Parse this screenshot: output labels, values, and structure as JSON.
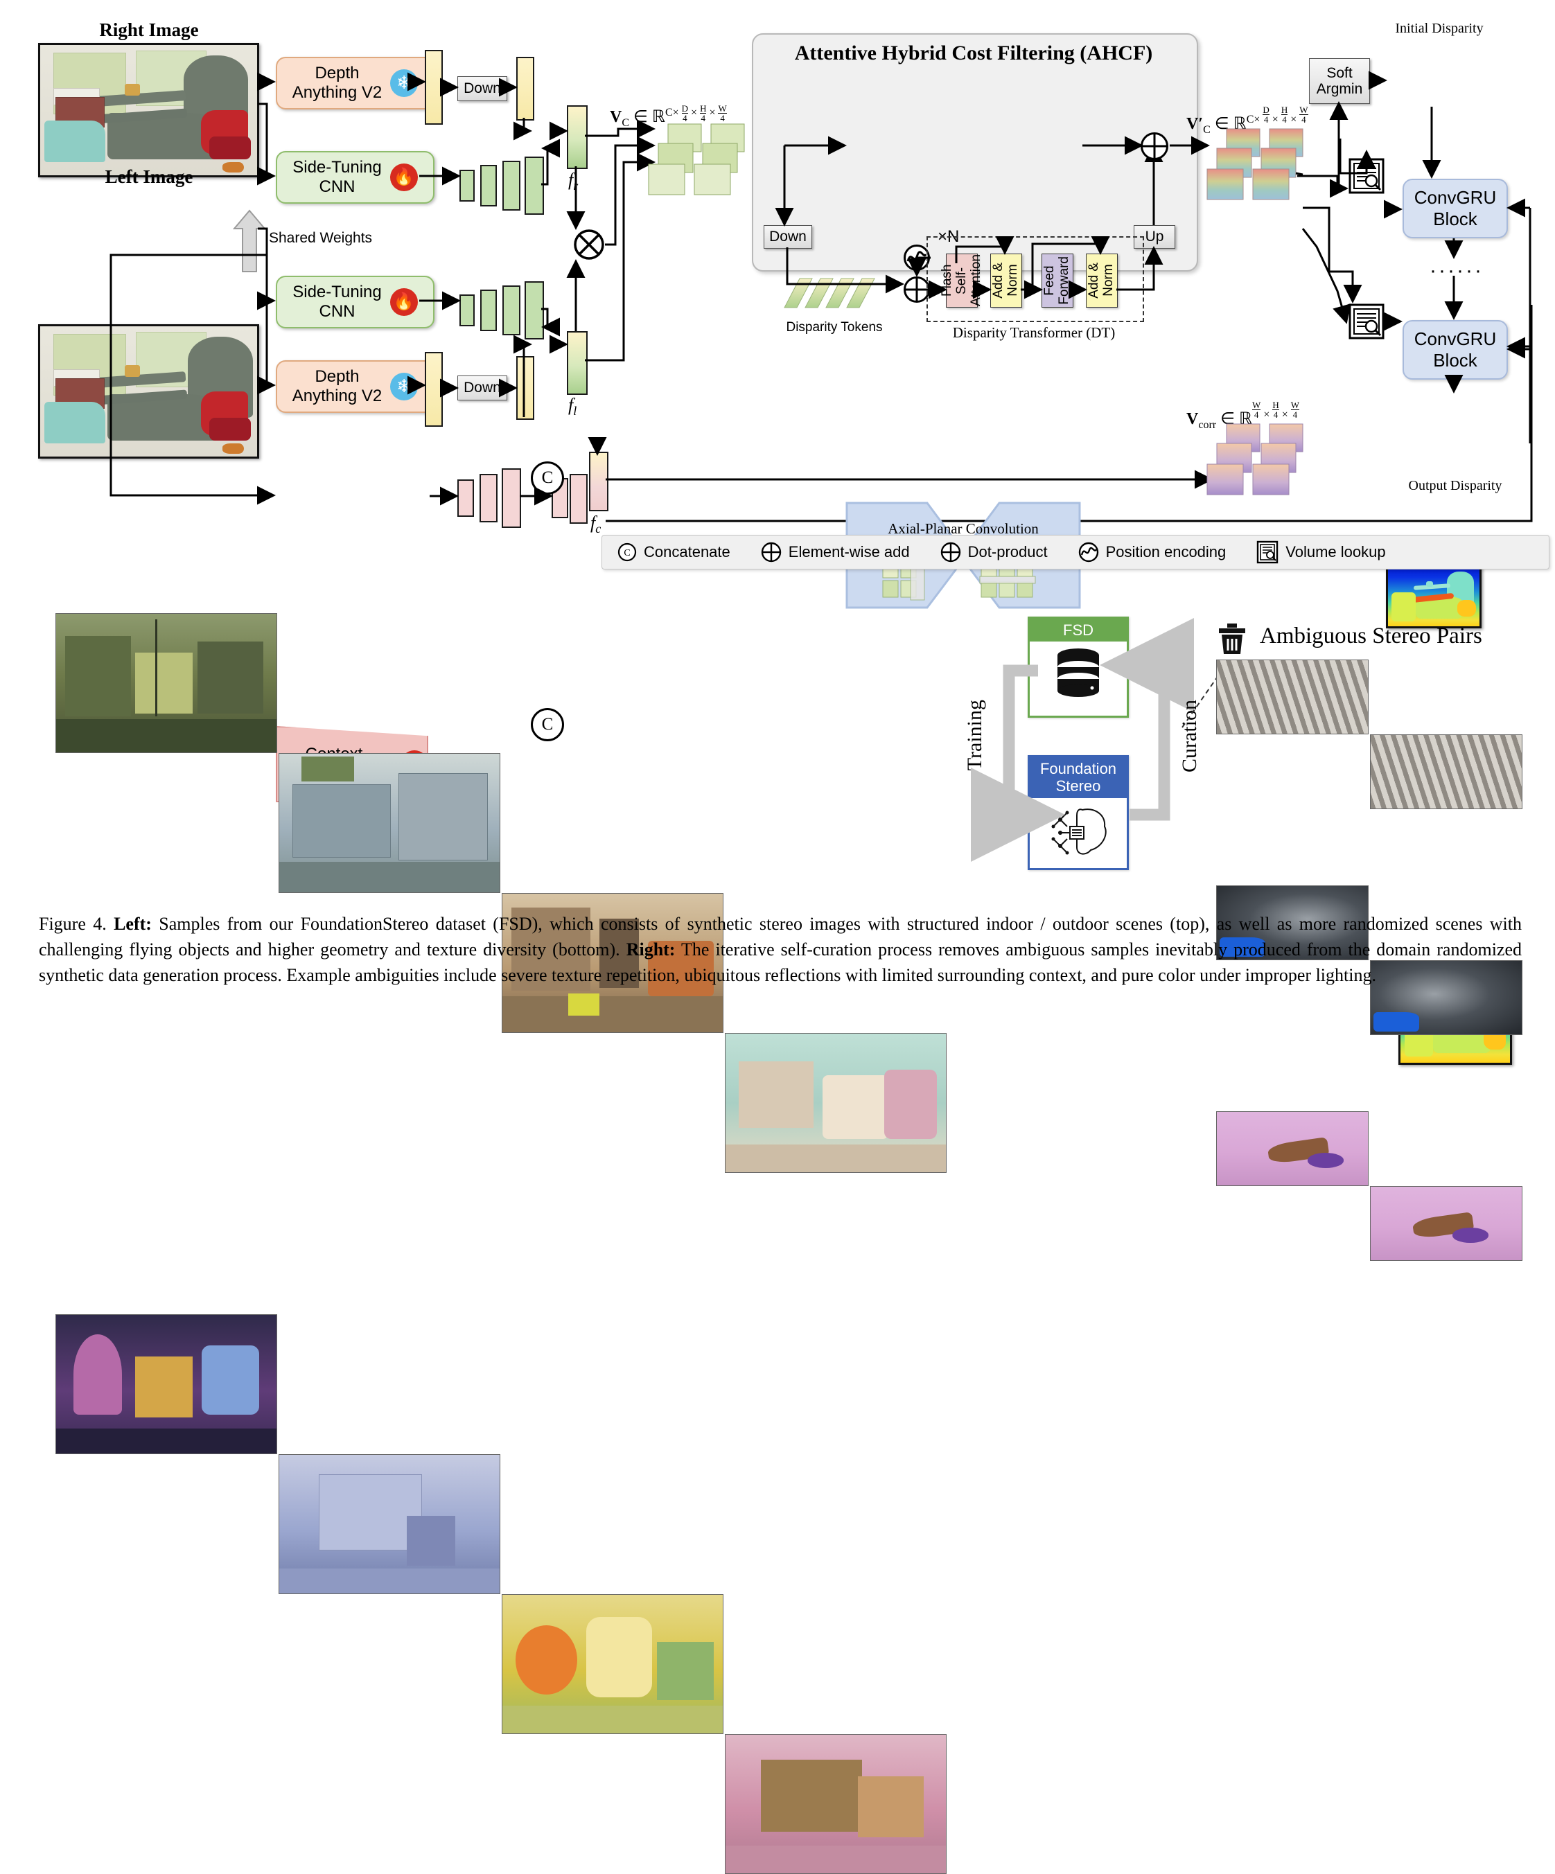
{
  "figure": {
    "number": "Figure 4.",
    "caption_parts": {
      "left_bold": "Left:",
      "left_text": " Samples from our FoundationStereo dataset (FSD), which consists of synthetic stereo images with structured indoor / outdoor scenes (top), as well as more randomized scenes with challenging flying objects and higher geometry and texture diversity (bottom). ",
      "right_bold": "Right:",
      "right_text": " The iterative self-curation process removes ambiguous samples inevitably produced from the domain randomized synthetic data generation process. Example ambiguities include severe texture repetition, ubiquitous reflections with limited surrounding context, and pure color under improper lighting."
    }
  },
  "pipeline": {
    "right_image_label": "Right Image",
    "left_image_label": "Left Image",
    "depth_anything_label": "Depth\nAnything V2",
    "side_tuning_label": "Side-Tuning\nCNN",
    "context_network_label": "Context\nNetwork",
    "shared_weights_label": "Shared Weights",
    "down_label": "Down",
    "up_label": "Up",
    "soft_argmin_label": "Soft\nArgmin",
    "convgru_label": "ConvGRU\nBlock",
    "initial_disparity_label": "Initial Disparity",
    "output_disparity_label": "Output Disparity",
    "ellipsis": "······",
    "f_r": "f",
    "f_r_sub": "r",
    "f_l": "f",
    "f_l_sub": "l",
    "f_c": "f",
    "f_c_sub": "c",
    "snowflake_icon": "frozen-icon",
    "fire_icon": "trainable-icon",
    "tensors": {
      "vc": "V",
      "vc_sub": "C",
      "vc_space": " ∈ ℝ",
      "vc_dims": [
        "C×",
        "D",
        "4",
        "H",
        "4",
        "W",
        "4"
      ],
      "vc_prime": "V′",
      "vcorr": "V",
      "vcorr_sub": "corr"
    }
  },
  "ahcf": {
    "title": "Attentive Hybrid Cost Filtering (AHCF)",
    "apc_label": "Axial-Planar Convolution\n(APC) Filtering",
    "repeat_label": "×N",
    "disparity_tokens_label": "Disparity Tokens",
    "dt_label": "Disparity Transformer (DT)",
    "dt_blocks": [
      {
        "name": "flash-self-attention",
        "label": "Flash Self-\nAttention",
        "color": "#f0cecb"
      },
      {
        "name": "add-norm-1",
        "label": "Add &\nNorm",
        "color": "#fbf7b8"
      },
      {
        "name": "feed-forward",
        "label": "Feed\nForward",
        "color": "#cdc4e0"
      },
      {
        "name": "add-norm-2",
        "label": "Add &\nNorm",
        "color": "#fbf7b8"
      }
    ]
  },
  "legend": {
    "items": [
      {
        "icon": "concatenate-icon",
        "glyph": "C",
        "label": "Concatenate"
      },
      {
        "icon": "element-wise-add-icon",
        "glyph": "plus-circle",
        "label": "Element-wise add"
      },
      {
        "icon": "dot-product-icon",
        "glyph": "plus-circle",
        "label": "Dot-product"
      },
      {
        "icon": "position-encoding-icon",
        "glyph": "sine-circle",
        "label": "Position encoding"
      },
      {
        "icon": "volume-lookup-icon",
        "glyph": "document-search",
        "label": "Volume lookup"
      }
    ]
  },
  "curation": {
    "fsd_label": "FSD",
    "foundation_stereo_label": "Foundation\nStereo",
    "training_label": "Training",
    "curation_label": "Curation",
    "ambiguous_label": "Ambiguous Stereo Pairs",
    "trash_icon": "trash-icon",
    "database_icon": "database-icon",
    "brain_chip_icon": "brain-chip-icon"
  },
  "samples": {
    "rows": [
      [
        {
          "name": "sample-street-scene",
          "c1": "#6e7a4a",
          "c2": "#b9c07a",
          "c3": "#3d4a2e"
        },
        {
          "name": "sample-building-scene",
          "c1": "#9fb0bb",
          "c2": "#7d8f8e",
          "c3": "#cfd8d6"
        },
        {
          "name": "sample-warehouse-scene",
          "c1": "#b99a72",
          "c2": "#7a6248",
          "c3": "#d7c4a4"
        },
        {
          "name": "sample-indoor-clutter",
          "c1": "#a9cfc4",
          "c2": "#d8c9b4",
          "c3": "#e7dcc6"
        }
      ],
      [
        {
          "name": "sample-random-purple",
          "c1": "#5f3c78",
          "c2": "#b56aa8",
          "c3": "#2f2a4a"
        },
        {
          "name": "sample-random-lavender",
          "c1": "#9aa6cf",
          "c2": "#c6cbe2",
          "c3": "#6f7ba8"
        },
        {
          "name": "sample-random-yellow",
          "c1": "#d8c445",
          "c2": "#8fb46a",
          "c3": "#e6d98a"
        },
        {
          "name": "sample-random-pink",
          "c1": "#cf8fa8",
          "c2": "#9b7b4e",
          "c3": "#e0b7c6"
        }
      ]
    ]
  },
  "ambiguous": {
    "pairs": [
      {
        "name": "ambiguous-texture-repetition",
        "tone": "#b8b3ac"
      },
      {
        "name": "ambiguous-reflection",
        "tone": "#2d3136"
      },
      {
        "name": "ambiguous-pure-color",
        "tone": "#d9a7d6"
      }
    ]
  }
}
